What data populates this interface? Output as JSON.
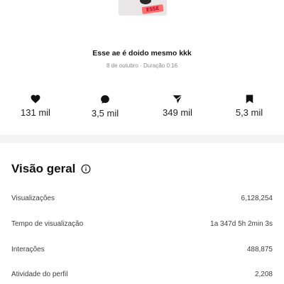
{
  "post": {
    "thumbnail_sticker_text": "ESSE",
    "caption": "Esse ae é doido mesmo kkk",
    "meta": "8 de outubro · Duração 0:16"
  },
  "stats": [
    {
      "icon": "heart-icon",
      "value": "131 mil"
    },
    {
      "icon": "comment-icon",
      "value": "3,5 mil"
    },
    {
      "icon": "share-icon",
      "value": "349 mil"
    },
    {
      "icon": "bookmark-icon",
      "value": "5,3 mil"
    }
  ],
  "overview": {
    "title": "Visão geral",
    "info_icon": "info-icon",
    "rows": [
      {
        "label": "Visualizações",
        "value": "6,128,254"
      },
      {
        "label": "Tempo de visualização",
        "value": "1a 347d 5h 2min 3s"
      },
      {
        "label": "Interações",
        "value": "488,875"
      },
      {
        "label": "Atividade do perfil",
        "value": "2,208"
      }
    ]
  },
  "colors": {
    "text": "#111111",
    "muted": "#8a8a8a",
    "divider": "#f3f3f3"
  }
}
